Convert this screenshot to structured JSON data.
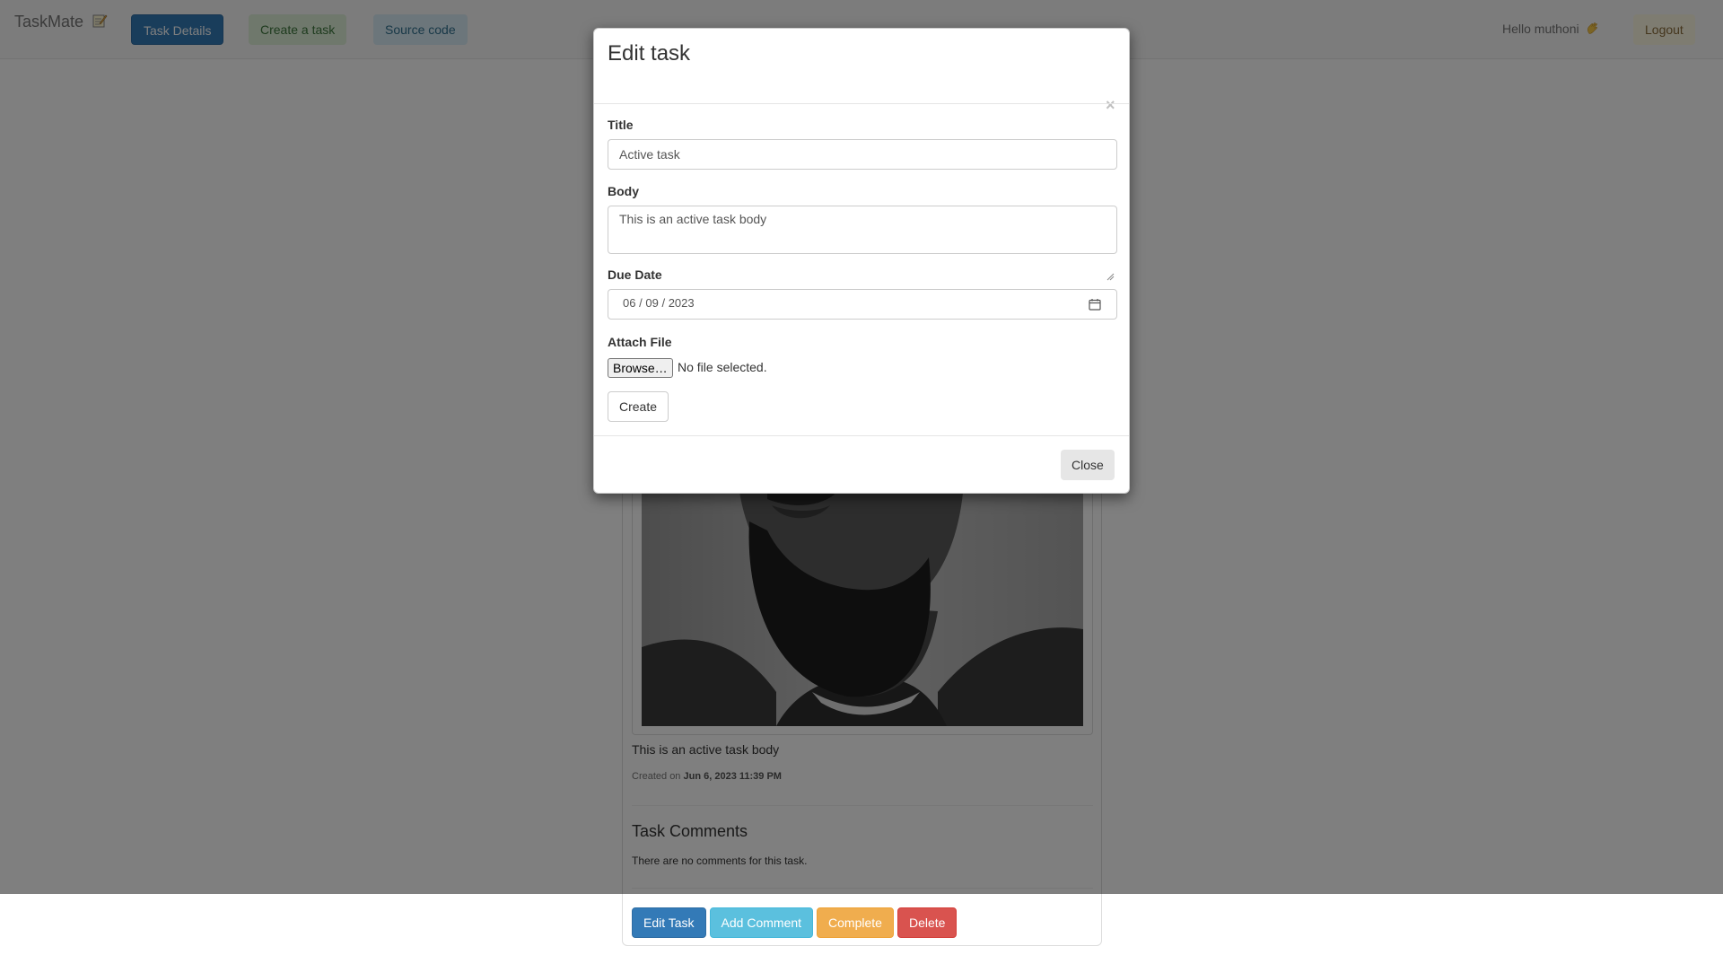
{
  "navbar": {
    "brand": "TaskMate",
    "brand_icon": "memo-pencil-icon",
    "links": {
      "task_details": "Task Details",
      "create_task": "Create a task",
      "source_code": "Source code"
    },
    "greeting": "Hello muthoni",
    "greeting_icon": "waving-hand-icon",
    "logout": "Logout"
  },
  "task": {
    "body": "This is an active task body",
    "created_prefix": "Created on",
    "created_date": "Jun 6, 2023 11:39 PM",
    "comments_title": "Task Comments",
    "no_comments": "There are no comments for this task.",
    "actions": {
      "edit": "Edit Task",
      "comment": "Add Comment",
      "complete": "Complete",
      "delete": "Delete"
    }
  },
  "modal": {
    "title": "Edit task",
    "close_symbol": "×",
    "fields": {
      "title_label": "Title",
      "title_value": "Active task",
      "body_label": "Body",
      "body_value": "This is an active task body",
      "due_label": "Due Date",
      "due_month": "06",
      "due_day": "09",
      "due_year": "2023",
      "date_separator": "/",
      "file_label": "Attach File",
      "browse": "Browse…",
      "file_status": "No file selected."
    },
    "submit": "Create",
    "close": "Close"
  },
  "colors": {
    "primary": "#337ab7",
    "info": "#5bc0de",
    "warning": "#f0ad4e",
    "danger": "#d9534f"
  }
}
